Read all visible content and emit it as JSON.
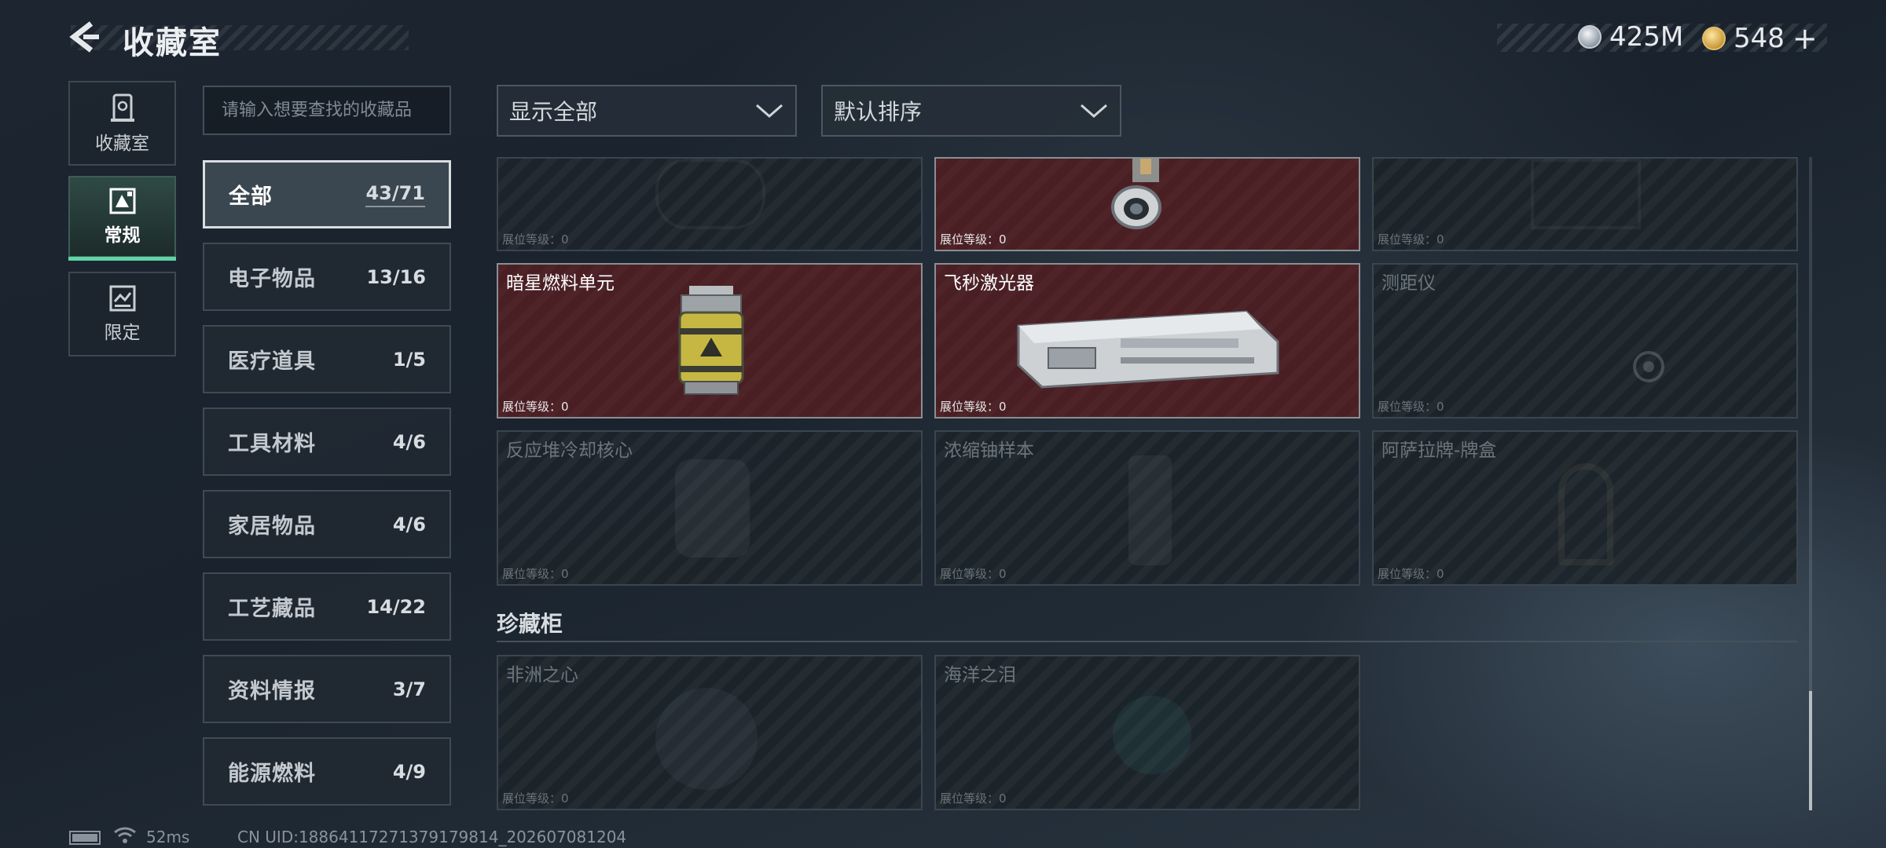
{
  "header": {
    "title": "收藏室",
    "back_icon": "back-arrow-icon"
  },
  "currency": {
    "silver": "425M",
    "gold": "548",
    "plus": "+"
  },
  "nav": [
    {
      "label": "收藏室",
      "icon": "collection-room-icon"
    },
    {
      "label": "常规",
      "icon": "regular-icon"
    },
    {
      "label": "限定",
      "icon": "limited-icon"
    }
  ],
  "search": {
    "placeholder": "请输入想要查找的收藏品"
  },
  "categories": [
    {
      "name": "全部",
      "count": "43/71"
    },
    {
      "name": "电子物品",
      "count": "13/16"
    },
    {
      "name": "医疗道具",
      "count": "1/5"
    },
    {
      "name": "工具材料",
      "count": "4/6"
    },
    {
      "name": "家居物品",
      "count": "4/6"
    },
    {
      "name": "工艺藏品",
      "count": "14/22"
    },
    {
      "name": "资料情报",
      "count": "3/7"
    },
    {
      "name": "能源燃料",
      "count": "4/9"
    }
  ],
  "filters": {
    "show": "显示全部",
    "sort": "默认排序"
  },
  "level_label": "展位等级：0",
  "items": [
    {
      "name": "",
      "owned": false
    },
    {
      "name": "",
      "owned": true
    },
    {
      "name": "",
      "owned": false
    },
    {
      "name": "暗星燃料单元",
      "owned": true
    },
    {
      "name": "飞秒激光器",
      "owned": true
    },
    {
      "name": "测距仪",
      "owned": false
    },
    {
      "name": "反应堆冷却核心",
      "owned": false
    },
    {
      "name": "浓缩铀样本",
      "owned": false
    },
    {
      "name": "阿萨拉牌-牌盒",
      "owned": false
    }
  ],
  "section": {
    "title": "珍藏柜"
  },
  "treasure_items": [
    {
      "name": "非洲之心",
      "owned": false
    },
    {
      "name": "海洋之泪",
      "owned": false
    }
  ],
  "status": {
    "ping": "52ms",
    "uid": "CN UID:18864117271379179814_202607081204"
  },
  "colors": {
    "accent_green": "#5fd4a5",
    "owned_bg": "#4a1f24"
  }
}
